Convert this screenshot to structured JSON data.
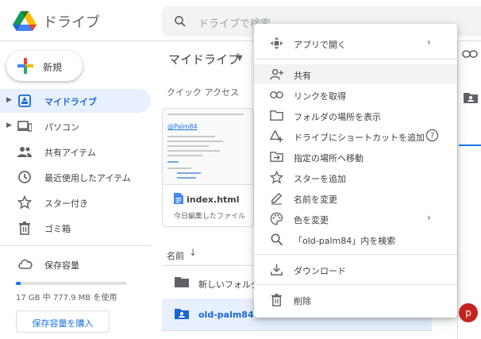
{
  "app": {
    "title": "ドライブ"
  },
  "search": {
    "placeholder": "ドライブで検索"
  },
  "sidebar": {
    "new_label": "新規",
    "items": [
      {
        "label": "マイドライブ",
        "icon": "my-drive-icon",
        "active": true
      },
      {
        "label": "パソコン",
        "icon": "computer-icon"
      },
      {
        "label": "共有アイテム",
        "icon": "shared-icon"
      },
      {
        "label": "最近使用したアイテム",
        "icon": "clock-icon"
      },
      {
        "label": "スター付き",
        "icon": "star-icon"
      },
      {
        "label": "ゴミ箱",
        "icon": "trash-icon"
      }
    ],
    "storage": {
      "label": "保存容量",
      "used_text": "17 GB 中 777.9 MB を使用",
      "used_fraction": 0.045,
      "buy_label": "保存容量を購入"
    }
  },
  "main": {
    "title": "マイドライブ",
    "quick_access_title": "クイック アクセス",
    "quick_card": {
      "thumb_heading": "@Palm84",
      "name": "index.html",
      "subtitle": "今日編集したファイル"
    },
    "sort_label": "名前",
    "rows": [
      {
        "name": "新しいフォルダー"
      },
      {
        "name": "old-palm84",
        "selected": true
      }
    ]
  },
  "context_menu": {
    "items": [
      {
        "label": "アプリで開く",
        "icon": "open-with-icon",
        "submenu": true
      },
      {
        "label": "共有",
        "icon": "share-person-icon",
        "highlight": true
      },
      {
        "label": "リンクを取得",
        "icon": "link-icon"
      },
      {
        "label": "フォルダの場所を表示",
        "icon": "folder-icon"
      },
      {
        "label": "ドライブにショートカットを追加",
        "icon": "add-shortcut-icon",
        "help": true
      },
      {
        "label": "指定の場所へ移動",
        "icon": "move-icon"
      },
      {
        "label": "スターを追加",
        "icon": "star-icon"
      },
      {
        "label": "名前を変更",
        "icon": "pencil-icon"
      },
      {
        "label": "色を変更",
        "icon": "palette-icon",
        "submenu": true
      },
      {
        "label": "「old-palm84」内を検索",
        "icon": "search-icon"
      },
      {
        "label": "ダウンロード",
        "icon": "download-icon"
      },
      {
        "label": "削除",
        "icon": "trash-icon"
      }
    ]
  },
  "avatar": {
    "initial": "p"
  },
  "colors": {
    "accent": "#1a73e8",
    "active_bg": "#e8f0fe",
    "avatar": "#c5221f"
  }
}
